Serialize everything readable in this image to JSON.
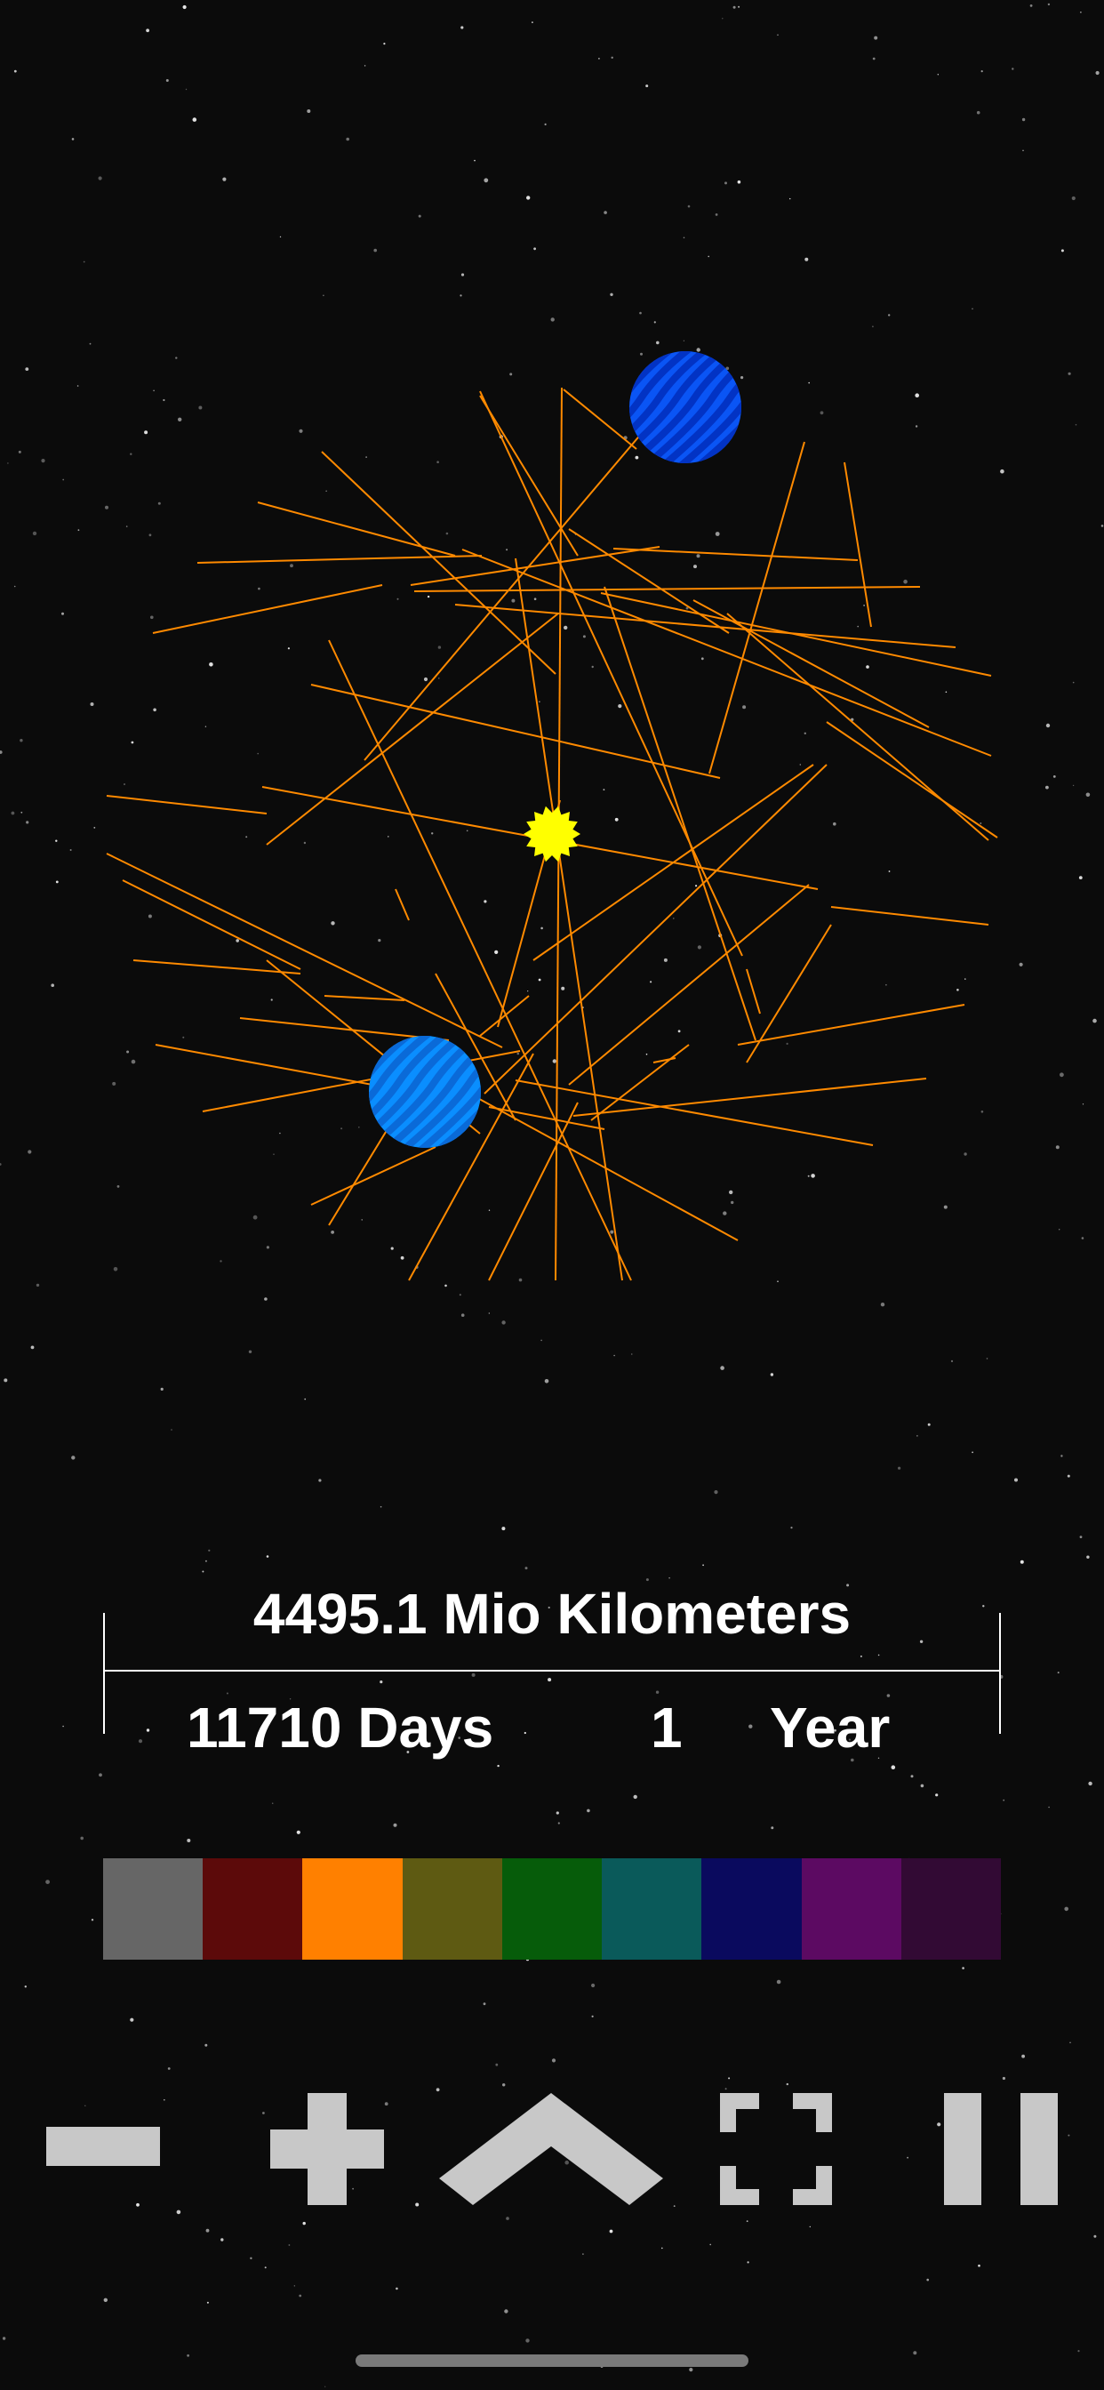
{
  "info": {
    "distance": "4495.1 Mio Kilometers",
    "days": "11710 Days",
    "year_count": "1",
    "year_label": "Year"
  },
  "orbit_line_color": "#ff8a00",
  "sun_color": "#ffff00",
  "planets": [
    {
      "name": "outer-planet",
      "base_color": "#0a55f5",
      "stripe_color": "#0233c4"
    },
    {
      "name": "inner-planet",
      "base_color": "#0a8eff",
      "stripe_color": "#0a6ad8"
    }
  ],
  "palette": [
    {
      "name": "gray",
      "color": "#666666"
    },
    {
      "name": "dark-red",
      "color": "#5c0a0a"
    },
    {
      "name": "orange",
      "color": "#ff8000"
    },
    {
      "name": "olive",
      "color": "#5e5a12"
    },
    {
      "name": "green",
      "color": "#065c0a"
    },
    {
      "name": "teal",
      "color": "#0a5a5a"
    },
    {
      "name": "navy",
      "color": "#0a0a5e"
    },
    {
      "name": "purple",
      "color": "#5c0a62"
    },
    {
      "name": "dark-purple",
      "color": "#320a34"
    }
  ],
  "controls": {
    "color": "#c8c8c8",
    "buttons": [
      "zoom-out",
      "zoom-in",
      "expand",
      "fullscreen",
      "pause"
    ]
  }
}
